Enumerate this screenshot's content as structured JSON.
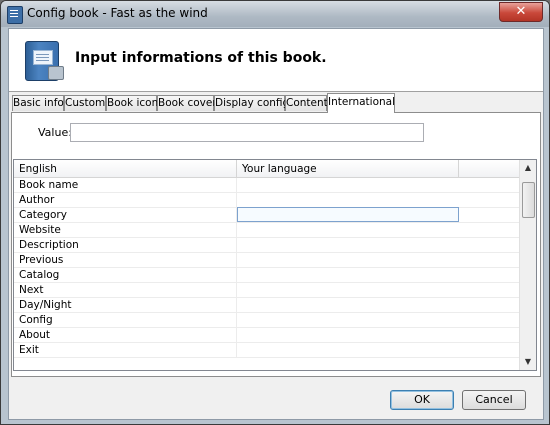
{
  "window": {
    "title": "Config book - Fast as the wind",
    "close_glyph": "✕"
  },
  "header": {
    "title": "Input informations of this book.",
    "icon": "book-settings-icon"
  },
  "tabs": [
    {
      "label": "Basic info",
      "active": false
    },
    {
      "label": "Custom",
      "active": false
    },
    {
      "label": "Book icon",
      "active": false
    },
    {
      "label": "Book cover",
      "active": false
    },
    {
      "label": "Display config",
      "active": false
    },
    {
      "label": "Content",
      "active": false
    },
    {
      "label": "International",
      "active": true
    }
  ],
  "value_field": {
    "label": "Value:",
    "value": ""
  },
  "grid": {
    "columns": [
      "English",
      "Your language"
    ],
    "rows": [
      {
        "english": "Book name",
        "translation": ""
      },
      {
        "english": "Author",
        "translation": ""
      },
      {
        "english": "Category",
        "translation": "",
        "selected": true
      },
      {
        "english": "Website",
        "translation": ""
      },
      {
        "english": "Description",
        "translation": ""
      },
      {
        "english": "Previous",
        "translation": ""
      },
      {
        "english": "Catalog",
        "translation": ""
      },
      {
        "english": "Next",
        "translation": ""
      },
      {
        "english": "Day/Night",
        "translation": ""
      },
      {
        "english": "Config",
        "translation": ""
      },
      {
        "english": "About",
        "translation": ""
      },
      {
        "english": "Exit",
        "translation": ""
      }
    ],
    "scroll_up_glyph": "▲",
    "scroll_down_glyph": "▼"
  },
  "buttons": {
    "ok": "OK",
    "cancel": "Cancel"
  }
}
